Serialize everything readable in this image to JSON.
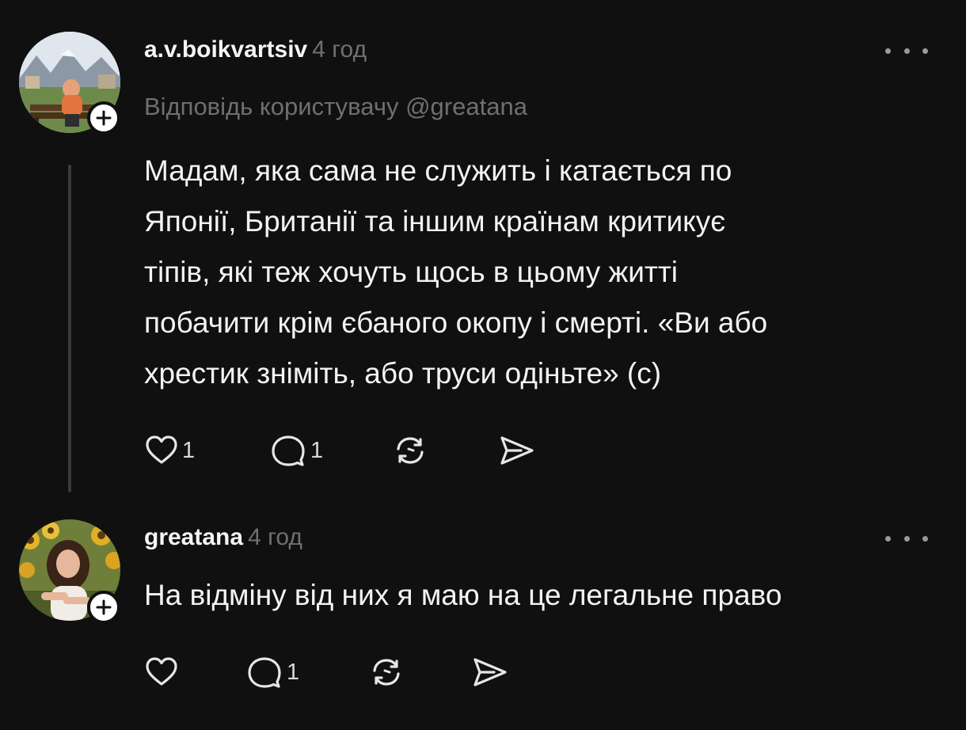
{
  "posts": [
    {
      "username": "a.v.boikvartsiv",
      "timestamp": "4 год",
      "reply_to": "Відповідь користувачу @greatana",
      "lines": [
        "Мадам, яка сама не служить і катається по",
        "Японії, Британії та іншим країнам критикує",
        "тіпів, які теж хочуть щось в цьому житті",
        "побачити крім єбаного окопу і смерті. «Ви або",
        "хрестик зніміть, або труси одіньте» (с)"
      ],
      "likes": "1",
      "replies": "1",
      "avatar_icon": "user-photo-man-on-bench",
      "badge_icon": "plus-icon"
    },
    {
      "username": "greatana",
      "timestamp": "4 год",
      "text": "На відміну від них я маю на це легальне право",
      "replies": "1",
      "avatar_icon": "user-photo-woman-sunflowers",
      "badge_icon": "plus-icon"
    }
  ],
  "icons": {
    "like": "heart-icon",
    "reply": "comment-icon",
    "repost": "repost-icon",
    "share": "send-icon",
    "more": "more-dots-icon"
  },
  "colors": {
    "background": "#101010",
    "text": "#f3f3f3",
    "muted": "#707070",
    "thread_line": "#3a3a3a"
  }
}
